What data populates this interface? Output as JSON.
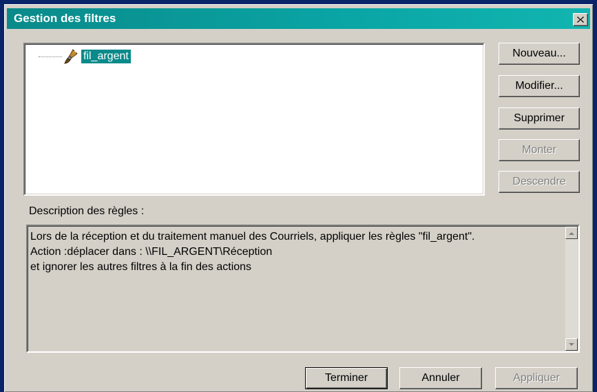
{
  "window": {
    "title": "Gestion des filtres"
  },
  "filters": {
    "items": [
      {
        "label": "fil_argent",
        "selected": true,
        "icon": "paintbrush-icon"
      }
    ]
  },
  "side_buttons": {
    "new_label": "Nouveau...",
    "edit_label": "Modifier...",
    "delete_label": "Supprimer",
    "up_label": "Monter",
    "down_label": "Descendre"
  },
  "description": {
    "label": "Description des règles :",
    "lines": [
      "Lors de la réception et du traitement manuel des Courriels, appliquer les règles \"fil_argent\".",
      "Action :déplacer dans : \\\\FIL_ARGENT\\Réception",
      "et ignorer les autres filtres à la fin des actions"
    ]
  },
  "footer": {
    "finish_label": "Terminer",
    "cancel_label": "Annuler",
    "apply_label": "Appliquer"
  },
  "colors": {
    "titlebar": "#0a8a8a",
    "selection": "#0a8a8a",
    "face": "#d4d0c8"
  }
}
